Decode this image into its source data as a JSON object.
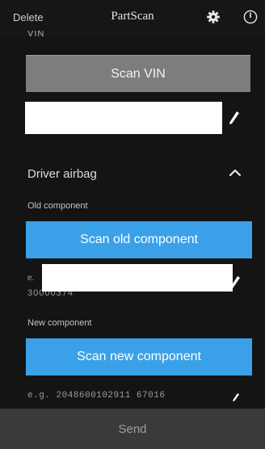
{
  "header": {
    "left_label": "Delete",
    "title": "PartScan",
    "gear_icon": "gear-icon",
    "power_icon": "power-icon"
  },
  "vin": {
    "section_label_partial": "VIN",
    "scan_button_label": "Scan VIN",
    "field_value": "",
    "edit_icon": "pencil-icon"
  },
  "component_section": {
    "title": "Driver airbag",
    "expanded": true,
    "old_component": {
      "label": "Old component",
      "scan_button_label": "Scan old component",
      "prefix": "e.",
      "value": "30000374",
      "field_value": "",
      "edit_icon": "pencil-icon"
    },
    "new_component": {
      "label": "New component",
      "scan_button_label": "Scan new component",
      "placeholder": "e.g. 2048600102911 67016",
      "edit_icon": "pencil-icon"
    }
  },
  "footer": {
    "send_label": "Send"
  },
  "colors": {
    "background": "#141414",
    "gray_button": "#7d7d7d",
    "blue_button": "#3aa1e8",
    "footer": "#3a3a3a"
  }
}
